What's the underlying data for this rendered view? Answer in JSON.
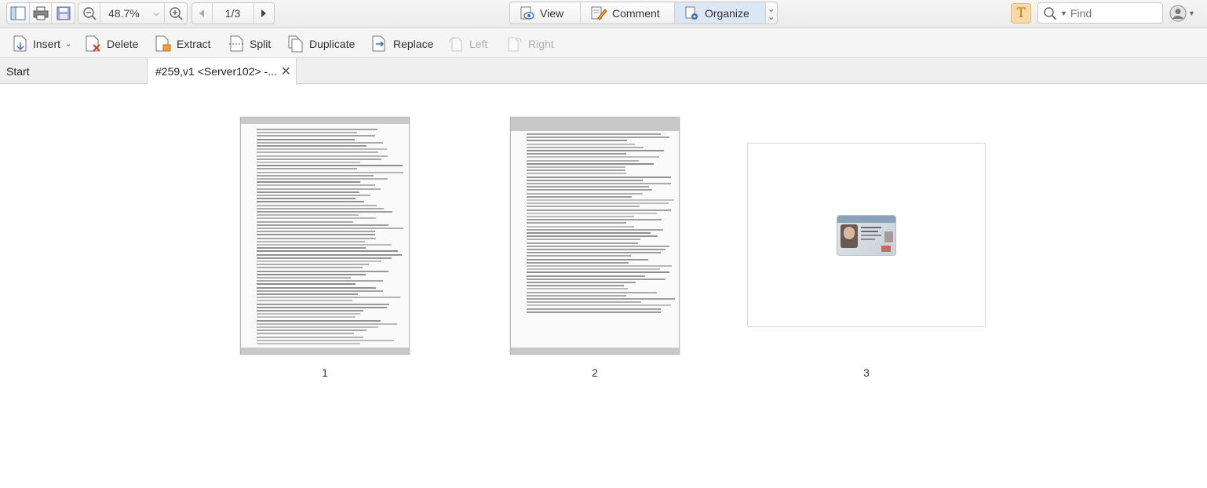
{
  "toolbar": {
    "zoom": "48.7%",
    "page_indicator": "1/3",
    "modes": [
      {
        "label": "View",
        "icon": "eye-icon"
      },
      {
        "label": "Comment",
        "icon": "comment-icon"
      },
      {
        "label": "Organize",
        "icon": "organize-icon"
      }
    ],
    "find_placeholder": "Find"
  },
  "organize_toolbar": {
    "insert": "Insert",
    "delete": "Delete",
    "extract": "Extract",
    "split": "Split",
    "duplicate": "Duplicate",
    "replace": "Replace",
    "left": "Left",
    "right": "Right"
  },
  "tabs": {
    "start": "Start",
    "document": "#259,v1 <Server102> -..."
  },
  "pages": [
    {
      "number": "1"
    },
    {
      "number": "2"
    },
    {
      "number": "3"
    }
  ],
  "colors": {
    "active_mode_bg": "#dbe7f5",
    "accent_orange": "#f0a040"
  }
}
